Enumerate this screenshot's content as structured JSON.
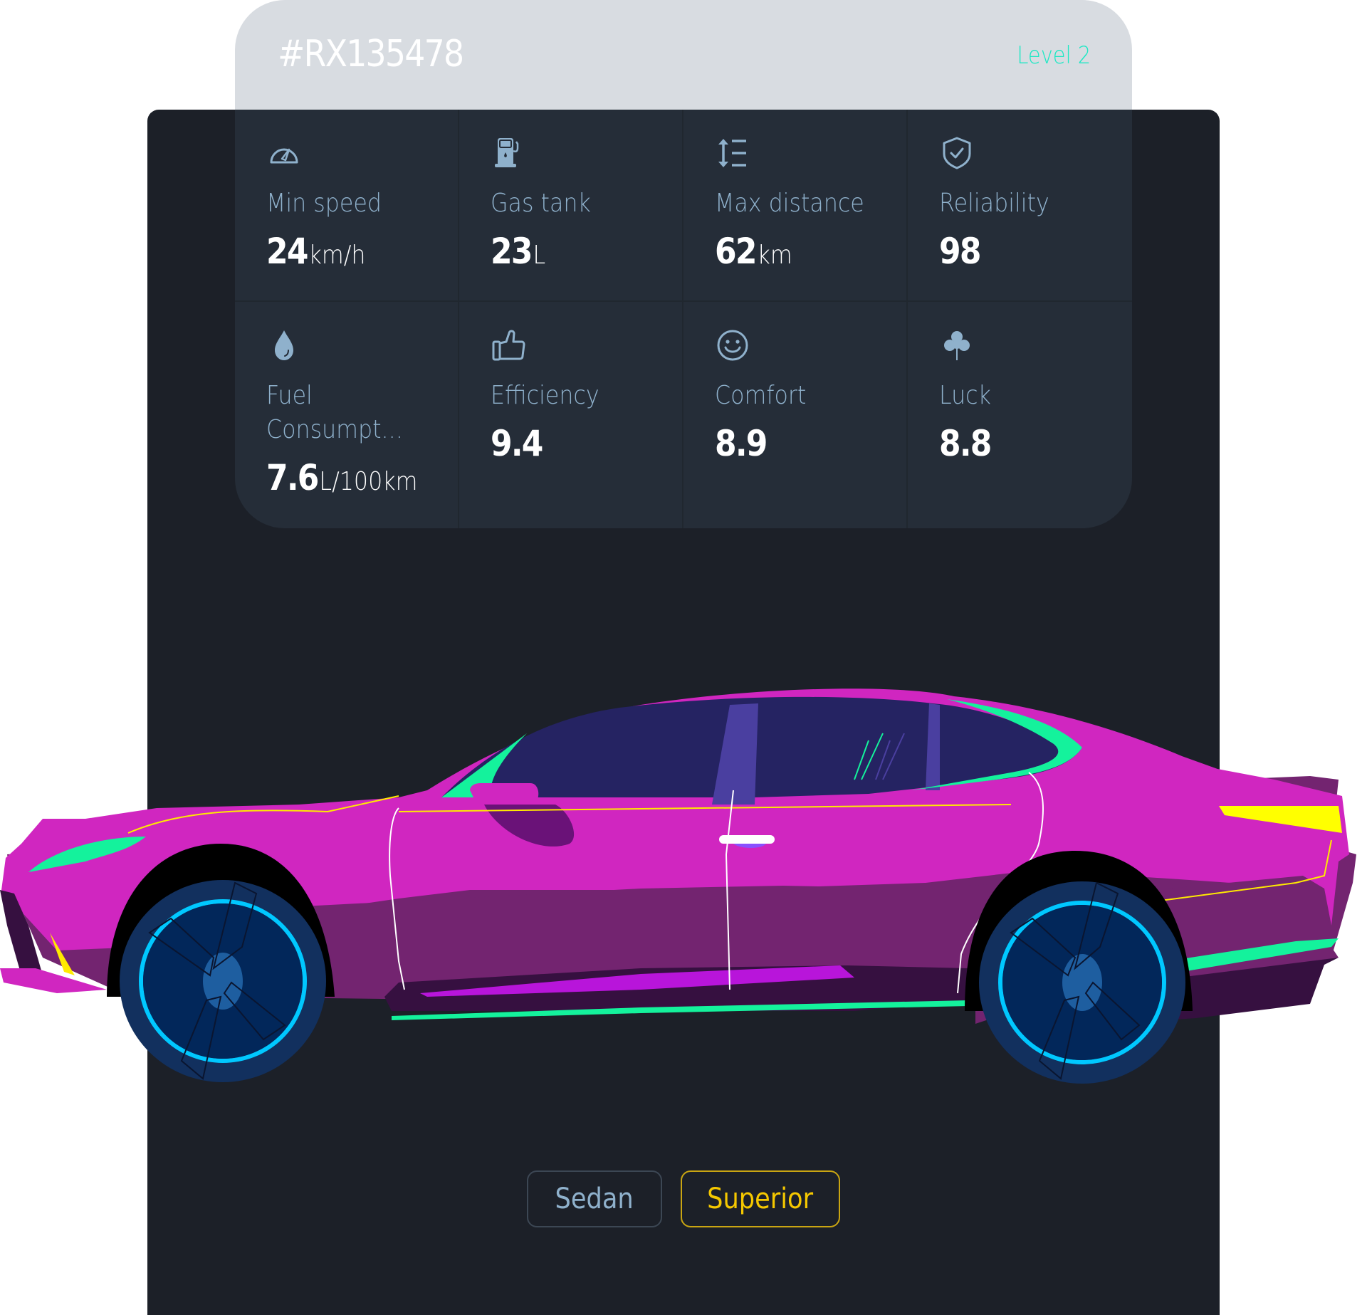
{
  "header": {
    "vehicle_id": "#RX135478",
    "level": "Level 2"
  },
  "stats": [
    {
      "icon": "speedometer-icon",
      "label": "Min speed",
      "value": "24",
      "unit": "km/h"
    },
    {
      "icon": "gas-pump-icon",
      "label": "Gas tank",
      "value": "23",
      "unit": "L"
    },
    {
      "icon": "distance-icon",
      "label": "Max distance",
      "value": "62",
      "unit": "km"
    },
    {
      "icon": "shield-check-icon",
      "label": "Reliability",
      "value": "98",
      "unit": ""
    },
    {
      "icon": "drop-icon",
      "label": "Fuel Consumpt...",
      "value": "7.6",
      "unit": "L/100km"
    },
    {
      "icon": "thumbs-up-icon",
      "label": "Efficiency",
      "value": "9.4",
      "unit": ""
    },
    {
      "icon": "smiley-icon",
      "label": "Comfort",
      "value": "8.9",
      "unit": ""
    },
    {
      "icon": "clover-icon",
      "label": "Luck",
      "value": "8.8",
      "unit": ""
    }
  ],
  "tags": {
    "type": "Sedan",
    "class": "Superior"
  },
  "colors": {
    "accent_teal": "#1ee8c4",
    "icon_blue": "#8fb1cc",
    "gold": "#f5c800",
    "car_body": "#d026c0"
  }
}
